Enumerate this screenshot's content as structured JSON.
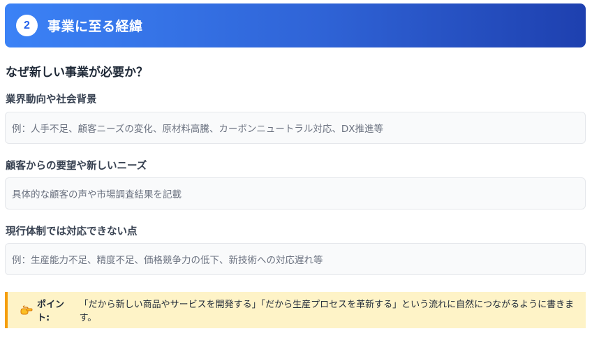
{
  "header": {
    "step_number": "2",
    "title": "事業に至る経緯"
  },
  "question": "なぜ新しい事業が必要か？",
  "fields": [
    {
      "label": "業界動向や社会背景",
      "placeholder": "例：人手不足、顧客ニーズの変化、原材料高騰、カーボンニュートラル対応、DX推進等"
    },
    {
      "label": "顧客からの要望や新しいニーズ",
      "placeholder": "具体的な顧客の声や市場調査結果を記載"
    },
    {
      "label": "現行体制では対応できない点",
      "placeholder": "例：生産能力不足、精度不足、価格競争力の低下、新技術への対応遅れ等"
    }
  ],
  "tip": {
    "icon": "pointing-hand-icon",
    "label": "ポイント:",
    "text": "「だから新しい商品やサービスを開発する」「だから生産プロセスを革新する」という流れに自然につながるように書きます。",
    "accent_color": "#f59e0b",
    "background_color": "#fef3c7"
  },
  "colors": {
    "header_start": "#3b82f6",
    "header_end": "#1e40af"
  }
}
